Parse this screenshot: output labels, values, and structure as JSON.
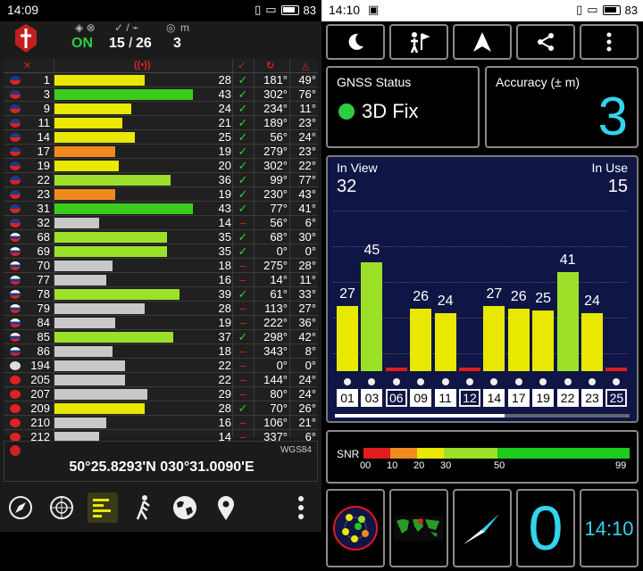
{
  "left": {
    "status": {
      "time": "14:09",
      "battery": "83"
    },
    "header": {
      "fix_label": "ON",
      "used_count": "15",
      "view_count": "26",
      "accuracy": "3",
      "used_sep": "/",
      "sats_label": "m"
    },
    "satellites": [
      {
        "flag": "us",
        "prn": "1",
        "snr": 28,
        "used": true,
        "az": "181°",
        "el": "49°",
        "bar": "yellow"
      },
      {
        "flag": "us",
        "prn": "3",
        "snr": 43,
        "used": true,
        "az": "302°",
        "el": "76°",
        "bar": "green"
      },
      {
        "flag": "us",
        "prn": "9",
        "snr": 24,
        "used": true,
        "az": "234°",
        "el": "11°",
        "bar": "yellow"
      },
      {
        "flag": "us",
        "prn": "11",
        "snr": 21,
        "used": true,
        "az": "189°",
        "el": "23°",
        "bar": "yellow"
      },
      {
        "flag": "us",
        "prn": "14",
        "snr": 25,
        "used": true,
        "az": "56°",
        "el": "24°",
        "bar": "yellow"
      },
      {
        "flag": "us",
        "prn": "17",
        "snr": 19,
        "used": true,
        "az": "279°",
        "el": "23°",
        "bar": "orange"
      },
      {
        "flag": "us",
        "prn": "19",
        "snr": 20,
        "used": true,
        "az": "302°",
        "el": "22°",
        "bar": "yellow"
      },
      {
        "flag": "us",
        "prn": "22",
        "snr": 36,
        "used": true,
        "az": "99°",
        "el": "77°",
        "bar": "lime"
      },
      {
        "flag": "us",
        "prn": "23",
        "snr": 19,
        "used": true,
        "az": "230°",
        "el": "43°",
        "bar": "orange"
      },
      {
        "flag": "us",
        "prn": "31",
        "snr": 43,
        "used": true,
        "az": "77°",
        "el": "41°",
        "bar": "green"
      },
      {
        "flag": "us",
        "prn": "32",
        "snr": 14,
        "used": false,
        "az": "56°",
        "el": "6°",
        "bar": "gray"
      },
      {
        "flag": "ru",
        "prn": "68",
        "snr": 35,
        "used": true,
        "az": "68°",
        "el": "30°",
        "bar": "lime"
      },
      {
        "flag": "ru",
        "prn": "69",
        "snr": 35,
        "used": true,
        "az": "0°",
        "el": "0°",
        "bar": "lime"
      },
      {
        "flag": "ru",
        "prn": "70",
        "snr": 18,
        "used": false,
        "az": "275°",
        "el": "28°",
        "bar": "gray"
      },
      {
        "flag": "ru",
        "prn": "77",
        "snr": 16,
        "used": false,
        "az": "14°",
        "el": "11°",
        "bar": "gray"
      },
      {
        "flag": "ru",
        "prn": "78",
        "snr": 39,
        "used": true,
        "az": "61°",
        "el": "33°",
        "bar": "lime"
      },
      {
        "flag": "ru",
        "prn": "79",
        "snr": 28,
        "used": false,
        "az": "113°",
        "el": "27°",
        "bar": "gray"
      },
      {
        "flag": "ru",
        "prn": "84",
        "snr": 19,
        "used": false,
        "az": "222°",
        "el": "36°",
        "bar": "gray"
      },
      {
        "flag": "ru",
        "prn": "85",
        "snr": 37,
        "used": true,
        "az": "298°",
        "el": "42°",
        "bar": "lime"
      },
      {
        "flag": "ru",
        "prn": "86",
        "snr": 18,
        "used": false,
        "az": "343°",
        "el": "8°",
        "bar": "gray"
      },
      {
        "flag": "unk",
        "prn": "194",
        "snr": 22,
        "used": false,
        "az": "0°",
        "el": "0°",
        "bar": "gray"
      },
      {
        "flag": "cn",
        "prn": "205",
        "snr": 22,
        "used": false,
        "az": "144°",
        "el": "24°",
        "bar": "gray"
      },
      {
        "flag": "cn",
        "prn": "207",
        "snr": 29,
        "used": false,
        "az": "80°",
        "el": "24°",
        "bar": "gray"
      },
      {
        "flag": "cn",
        "prn": "209",
        "snr": 28,
        "used": true,
        "az": "70°",
        "el": "26°",
        "bar": "yellow"
      },
      {
        "flag": "cn",
        "prn": "210",
        "snr": 16,
        "used": false,
        "az": "106°",
        "el": "21°",
        "bar": "gray"
      },
      {
        "flag": "cn",
        "prn": "212",
        "snr": 14,
        "used": false,
        "az": "337°",
        "el": "6°",
        "bar": "gray"
      }
    ],
    "coords": "50°25.8293'N   030°31.0090'E",
    "datum": "WGS84"
  },
  "right": {
    "status": {
      "time": "14:10",
      "battery": "83"
    },
    "gnss_status_title": "GNSS Status",
    "fix_text": "3D Fix",
    "accuracy_title": "Accuracy (± m)",
    "accuracy_value": "3",
    "in_view_label": "In View",
    "in_view_value": "32",
    "in_use_label": "In Use",
    "in_use_value": "15",
    "snr_bars": [
      {
        "prn": "01",
        "snr": 27,
        "used": true
      },
      {
        "prn": "03",
        "snr": 45,
        "used": true
      },
      {
        "prn": "06",
        "snr": null,
        "used": false
      },
      {
        "prn": "09",
        "snr": 26,
        "used": true
      },
      {
        "prn": "11",
        "snr": 24,
        "used": true
      },
      {
        "prn": "12",
        "snr": null,
        "used": false
      },
      {
        "prn": "14",
        "snr": 27,
        "used": true
      },
      {
        "prn": "17",
        "snr": 26,
        "used": true
      },
      {
        "prn": "19",
        "snr": 25,
        "used": true
      },
      {
        "prn": "22",
        "snr": 41,
        "used": true
      },
      {
        "prn": "23",
        "snr": 24,
        "used": true
      },
      {
        "prn": "25",
        "snr": null,
        "used": false
      }
    ],
    "snr_legend": {
      "label": "SNR",
      "ticks": [
        "00",
        "10",
        "20",
        "30",
        "50",
        "99"
      ]
    },
    "bottom_zero": "0",
    "bottom_clock": "14:10"
  },
  "colors": {
    "accent_cyan": "#33d4ee",
    "bar_yellow": "#e8e800",
    "bar_green": "#3ccc1c",
    "bar_lime": "#9ce02a",
    "bar_orange": "#f08a1c",
    "bar_gray": "#c8c8c8",
    "fix_green": "#2ecc40"
  }
}
